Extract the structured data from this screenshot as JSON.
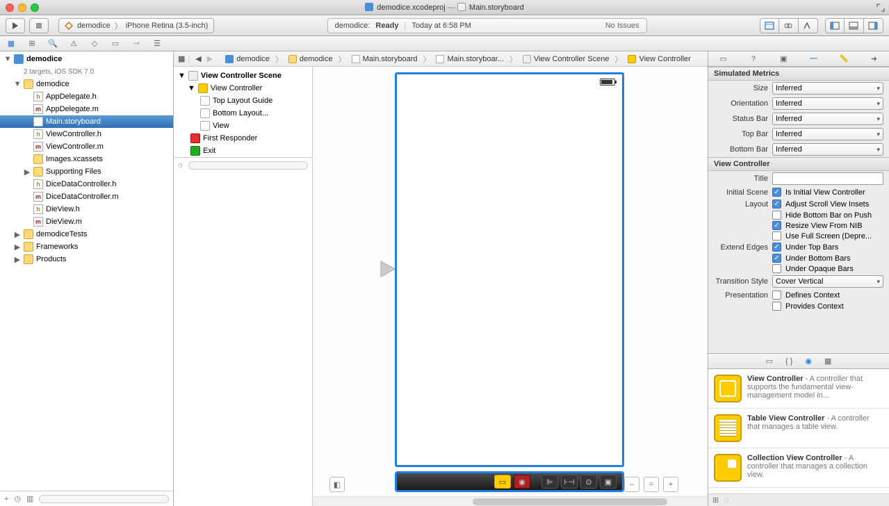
{
  "title": {
    "project": "demodice.xcodeproj",
    "file": "Main.storyboard"
  },
  "scheme": {
    "name": "demodice",
    "device": "iPhone Retina (3.5-inch)"
  },
  "status": {
    "project": "demodice:",
    "state": "Ready",
    "time": "Today at 6:58 PM",
    "issues": "No Issues"
  },
  "nav": {
    "project": "demodice",
    "subtitle": "2 targets, iOS SDK 7.0",
    "group": "demodice",
    "files": {
      "appdelegate_h": "AppDelegate.h",
      "appdelegate_m": "AppDelegate.m",
      "main_sb": "Main.storyboard",
      "vc_h": "ViewController.h",
      "vc_m": "ViewController.m",
      "images": "Images.xcassets",
      "supporting": "Supporting Files",
      "dicedata_h": "DiceDataController.h",
      "dicedata_m": "DiceDataController.m",
      "dieview_h": "DieView.h",
      "dieview_m": "DieView.m"
    },
    "groups": {
      "tests": "demodiceTests",
      "frameworks": "Frameworks",
      "products": "Products"
    }
  },
  "jumpbar": [
    "demodice",
    "demodice",
    "Main.storyboard",
    "Main.storyboar...",
    "View Controller Scene",
    "View Controller"
  ],
  "outline": {
    "scene": "View Controller Scene",
    "vc": "View Controller",
    "top": "Top Layout Guide",
    "bottom": "Bottom Layout...",
    "view": "View",
    "fr": "First Responder",
    "exit": "Exit"
  },
  "inspector": {
    "sim_head": "Simulated Metrics",
    "labels": {
      "size": "Size",
      "orientation": "Orientation",
      "statusbar": "Status Bar",
      "topbar": "Top Bar",
      "bottombar": "Bottom Bar"
    },
    "values": {
      "size": "Inferred",
      "orientation": "Inferred",
      "statusbar": "Inferred",
      "topbar": "Inferred",
      "bottombar": "Inferred"
    },
    "vc_head": "View Controller",
    "vc_labels": {
      "title": "Title",
      "initial": "Initial Scene",
      "layout": "Layout",
      "extend": "Extend Edges",
      "transition": "Transition Style",
      "presentation": "Presentation"
    },
    "vc_checks": {
      "initial": "Is Initial View Controller",
      "adjust": "Adjust Scroll View Insets",
      "hidebottom": "Hide Bottom Bar on Push",
      "resize": "Resize View From NIB",
      "fullscreen": "Use Full Screen (Depre...",
      "undertop": "Under Top Bars",
      "underbottom": "Under Bottom Bars",
      "underopaque": "Under Opaque Bars",
      "defines": "Defines Context",
      "provides": "Provides Context"
    },
    "transition_value": "Cover Vertical"
  },
  "library": [
    {
      "title": "View Controller",
      "desc": " - A controller that supports the fundamental view-management model in..."
    },
    {
      "title": "Table View Controller",
      "desc": " - A controller that manages a table view."
    },
    {
      "title": "Collection View Controller",
      "desc": " - A controller that manages a collection view."
    }
  ]
}
